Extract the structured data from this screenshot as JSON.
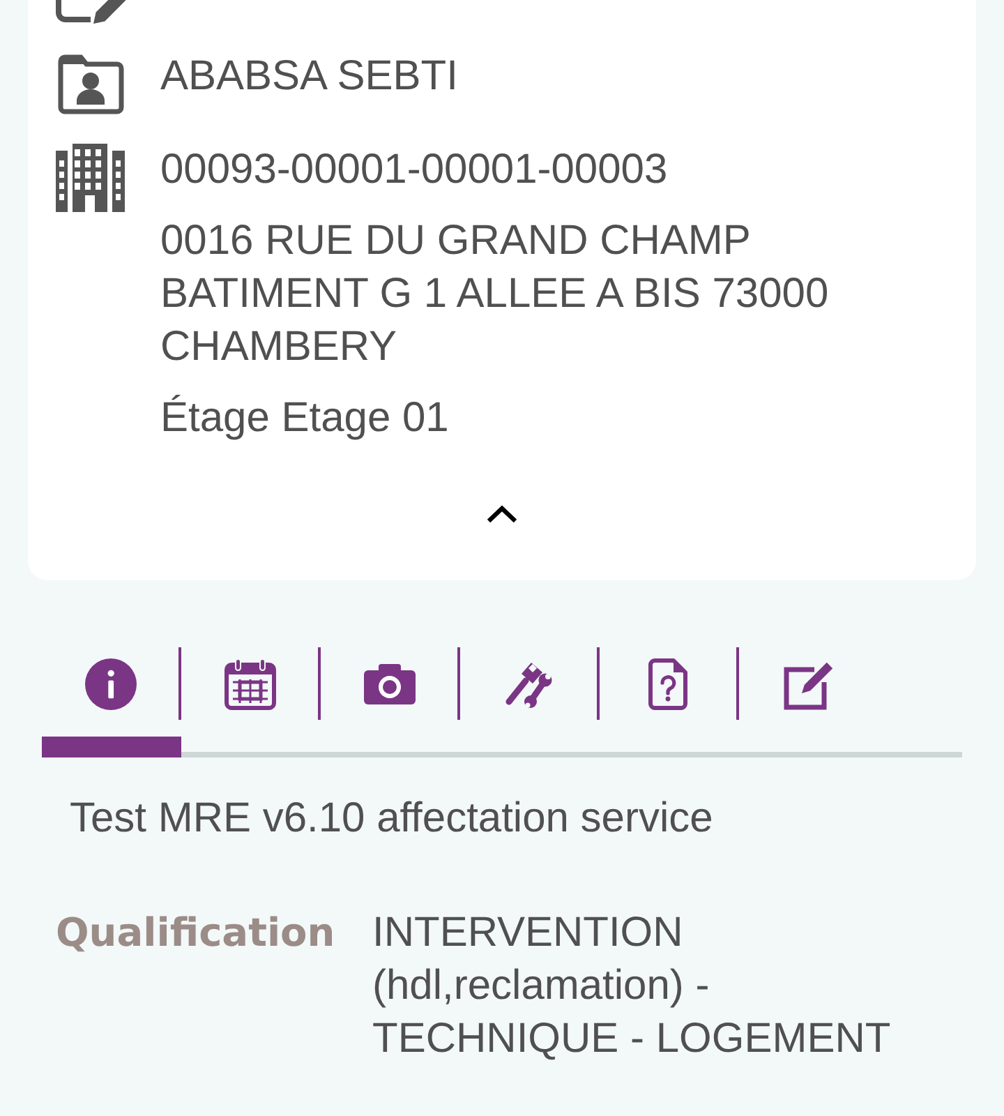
{
  "card": {
    "rows": [
      {
        "kind": "edit"
      },
      {
        "kind": "contact",
        "lines": [
          "ABABSA SEBTI"
        ]
      },
      {
        "kind": "building",
        "lines": [
          "00093-00001-00001-00003",
          "0016 RUE DU GRAND CHAMP BATIMENT G 1 ALLEE A BIS 73000 CHAMBERY",
          "Étage Etage 01"
        ]
      }
    ],
    "expanded": true
  },
  "tabs": [
    {
      "kind": "info",
      "selected": true
    },
    {
      "kind": "calendar",
      "selected": false
    },
    {
      "kind": "camera",
      "selected": false
    },
    {
      "kind": "tools",
      "selected": false
    },
    {
      "kind": "document",
      "selected": false
    },
    {
      "kind": "edit",
      "selected": false
    }
  ],
  "description": "Test MRE v6.10 affectation service",
  "fields": [
    {
      "label": "Qualification",
      "value": "INTERVENTION (hdl,reclamation) - TECHNIQUE - LOGEMENT"
    }
  ]
}
